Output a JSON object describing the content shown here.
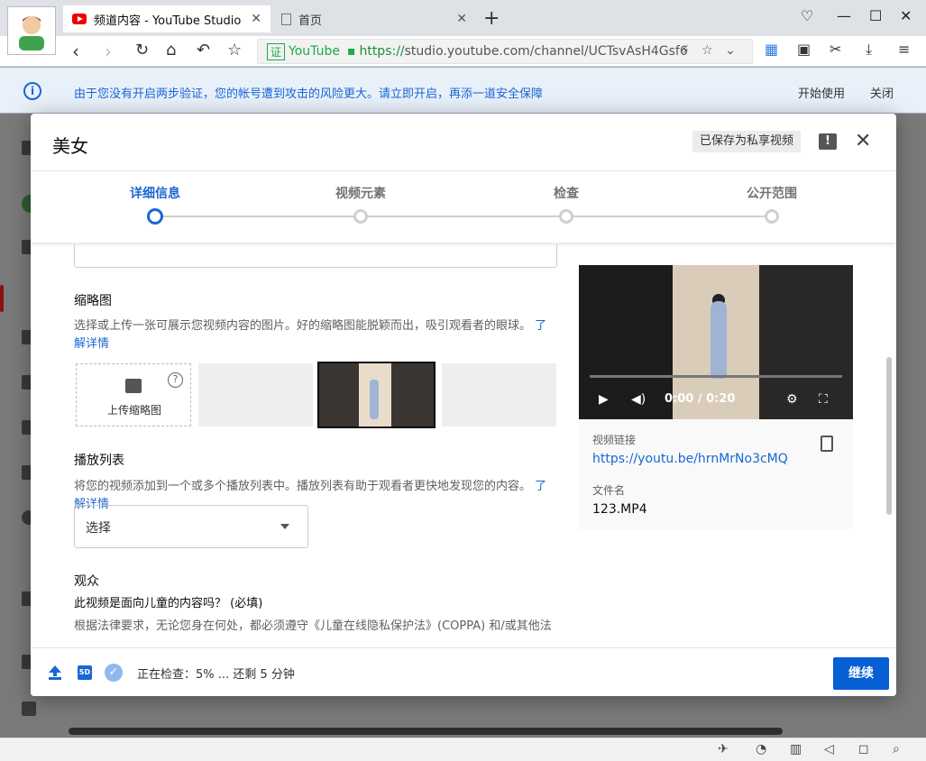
{
  "browser": {
    "tabs": [
      {
        "title": "频道内容 - YouTube Studio",
        "active": true
      },
      {
        "title": "首页",
        "active": false
      }
    ],
    "url": {
      "cert_label": "证",
      "site_label": "YouTube",
      "scheme": "https://",
      "rest": "studio.youtube.com/channel/UCTsvAsH4Gsf6"
    }
  },
  "banner": {
    "message": "由于您没有开启两步验证，您的帐号遭到攻击的风险更大。请立即开启，再添一道安全保障",
    "start_label": "开始使用",
    "close_label": "关闭"
  },
  "modal": {
    "title": "美女",
    "saved_label": "已保存为私享视频",
    "steps": [
      "详细信息",
      "视频元素",
      "检查",
      "公开范围"
    ],
    "thumbnail": {
      "title": "缩略图",
      "desc": "选择或上传一张可展示您视频内容的图片。好的缩略图能脱颖而出，吸引观看者的眼球。",
      "learn_more": "了解详情",
      "upload_label": "上传缩略图"
    },
    "playlist": {
      "title": "播放列表",
      "desc": "将您的视频添加到一个或多个播放列表中。播放列表有助于观看者更快地发现您的内容。",
      "learn_more": "了解详情",
      "select_value": "选择"
    },
    "audience": {
      "title": "观众",
      "question": "此视频是面向儿童的内容吗？ (必填)",
      "truncated": "根据法律要求，无论您身在何处，都必须遵守《儿童在线隐私保护法》(COPPA) 和/或其他法"
    },
    "video": {
      "time": "0:00 / 0:20",
      "link_label": "视频链接",
      "link": "https://youtu.be/hrnMrNo3cMQ",
      "file_label": "文件名",
      "file_name": "123.MP4"
    },
    "footer": {
      "sd_label": "SD",
      "status": "正在检查：5% ... 还剩 5 分钟",
      "continue_label": "继续"
    }
  }
}
